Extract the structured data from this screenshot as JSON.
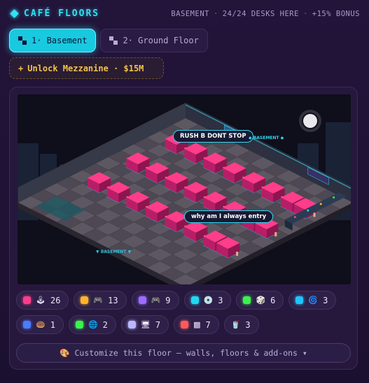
{
  "header": {
    "title": "CAFÉ FLOORS",
    "status_floor": "BASEMENT",
    "status_desks": "24/24 DESKS HERE",
    "status_bonus": "+15% BONUS",
    "separator": "·"
  },
  "tabs": [
    {
      "label": "1· Basement",
      "active": true
    },
    {
      "label": "2· Ground Floor",
      "active": false
    }
  ],
  "unlock": {
    "plus": "+",
    "label": "Unlock Mezzanine · $15M"
  },
  "scene": {
    "bubbles": [
      "RUSH B DONT STOP",
      "why am I always entry"
    ],
    "tags": [
      "◆ BASEMENT ◆",
      "▼ BASEMENT ▼"
    ]
  },
  "chips": [
    {
      "color": "#ff3d8a",
      "icon": "joystick-icon",
      "glyph": "🕹",
      "count": "26"
    },
    {
      "color": "#ffb42a",
      "icon": "gamepad-icon",
      "glyph": "🎮",
      "count": "13"
    },
    {
      "color": "#9b6cff",
      "icon": "gamepad-icon",
      "glyph": "🎮",
      "count": "9"
    },
    {
      "color": "#22d8f0",
      "icon": "disc-icon",
      "glyph": "💿",
      "count": "3"
    },
    {
      "color": "#3cf24c",
      "icon": "dice-icon",
      "glyph": "🎲",
      "count": "6"
    },
    {
      "color": "#1fc4ff",
      "icon": "spiral-icon",
      "glyph": "🌀",
      "count": "3"
    },
    {
      "color": "#4b7bff",
      "icon": "donut-icon",
      "glyph": "🍩",
      "count": "1"
    },
    {
      "color": "#3cf24c",
      "icon": "globe-icon",
      "glyph": "🌐",
      "count": "2"
    },
    {
      "color": "#b9b9ff",
      "icon": "computer-icon",
      "glyph": "🖥",
      "count": "7"
    },
    {
      "color": "#ff5a5a",
      "icon": "green-box-icon",
      "glyph": "▩",
      "count": "7"
    },
    {
      "color": "#ffffff",
      "icon": "cup-icon",
      "glyph": "🥤",
      "count": "3",
      "no_dot": true
    }
  ],
  "customize": {
    "icon": "palette-icon",
    "glyph": "🎨",
    "label": "Customize this floor — walls, floors & add-ons ▾"
  }
}
